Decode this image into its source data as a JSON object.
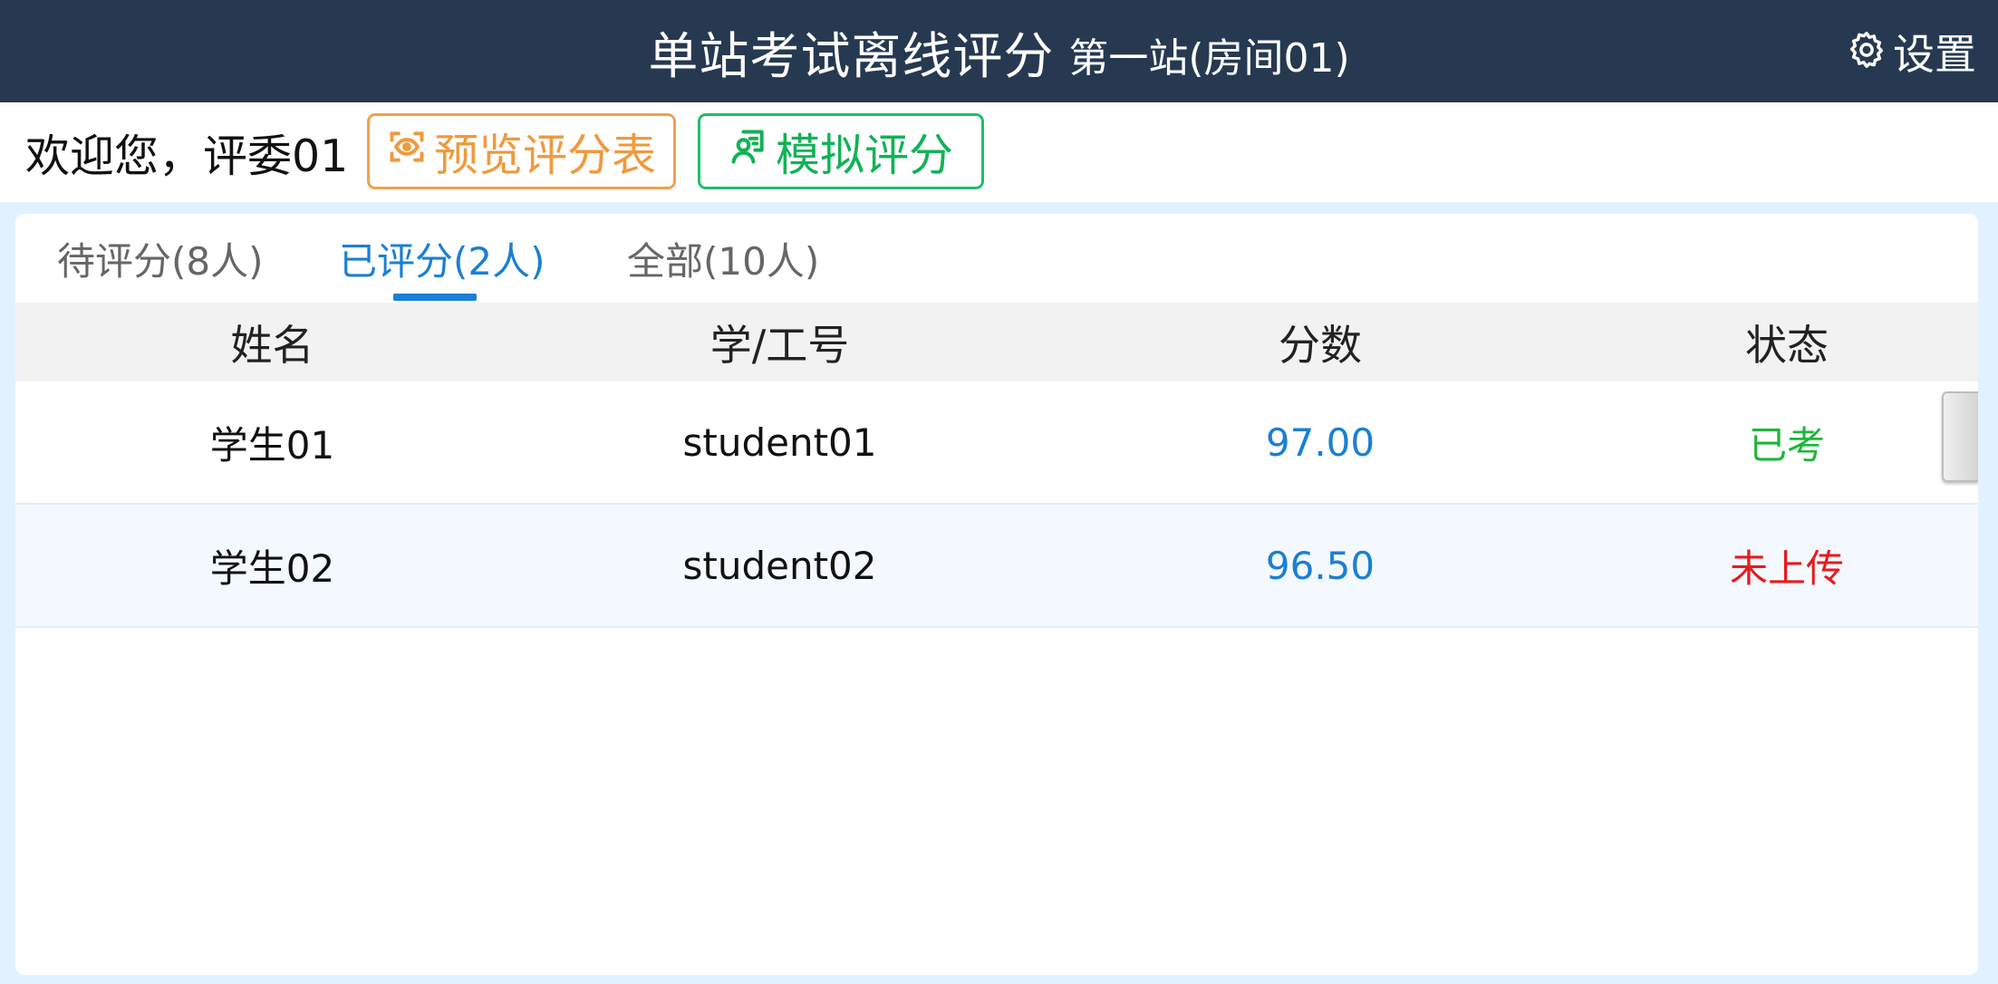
{
  "header": {
    "title": "单站考试离线评分",
    "station": "第一站(房间01)",
    "settings_label": "设置",
    "bg_color": "#263951"
  },
  "toolbar": {
    "welcome": "欢迎您，评委01",
    "preview_label": "预览评分表",
    "simulate_label": "模拟评分",
    "preview_color": "#ef9a3e",
    "simulate_color": "#12b257"
  },
  "tabs": [
    {
      "label": "待评分(8人)",
      "active": false
    },
    {
      "label": "已评分(2人)",
      "active": true
    },
    {
      "label": "全部(10人)",
      "active": false
    }
  ],
  "table": {
    "columns": [
      "姓名",
      "学/工号",
      "分数",
      "状态"
    ],
    "rows": [
      {
        "name": "学生01",
        "id": "student01",
        "score": "97.00",
        "status": "已考",
        "status_color": "#1fb53a"
      },
      {
        "name": "学生02",
        "id": "student02",
        "score": "96.50",
        "status": "未上传",
        "status_color": "#e51c1c"
      }
    ]
  },
  "icons": {
    "settings": "gear-icon",
    "preview": "eye-scan-icon",
    "simulate": "user-edit-icon"
  },
  "accent_color": "#1a7fd6"
}
